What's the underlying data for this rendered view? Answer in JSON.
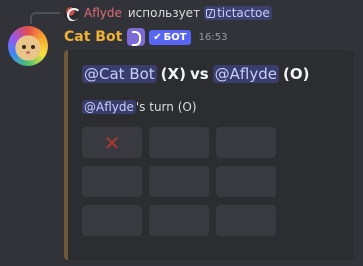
{
  "reply": {
    "author": "Aflyde",
    "action": "использует",
    "command": "tictactoe"
  },
  "message": {
    "author": "Cat Bot",
    "bot_tag": "БОТ",
    "timestamp": "16:53",
    "accent_color": "#f0b232"
  },
  "embed": {
    "player_x": "@Cat Bot",
    "symbol_x": "(X)",
    "vs": "vs",
    "player_o": "@Aflyde",
    "symbol_o": "(O)",
    "turn_mention": "@Aflyde",
    "turn_text": "'s turn (O)",
    "board": [
      "X",
      "",
      "",
      "",
      "",
      "",
      "",
      "",
      ""
    ]
  }
}
